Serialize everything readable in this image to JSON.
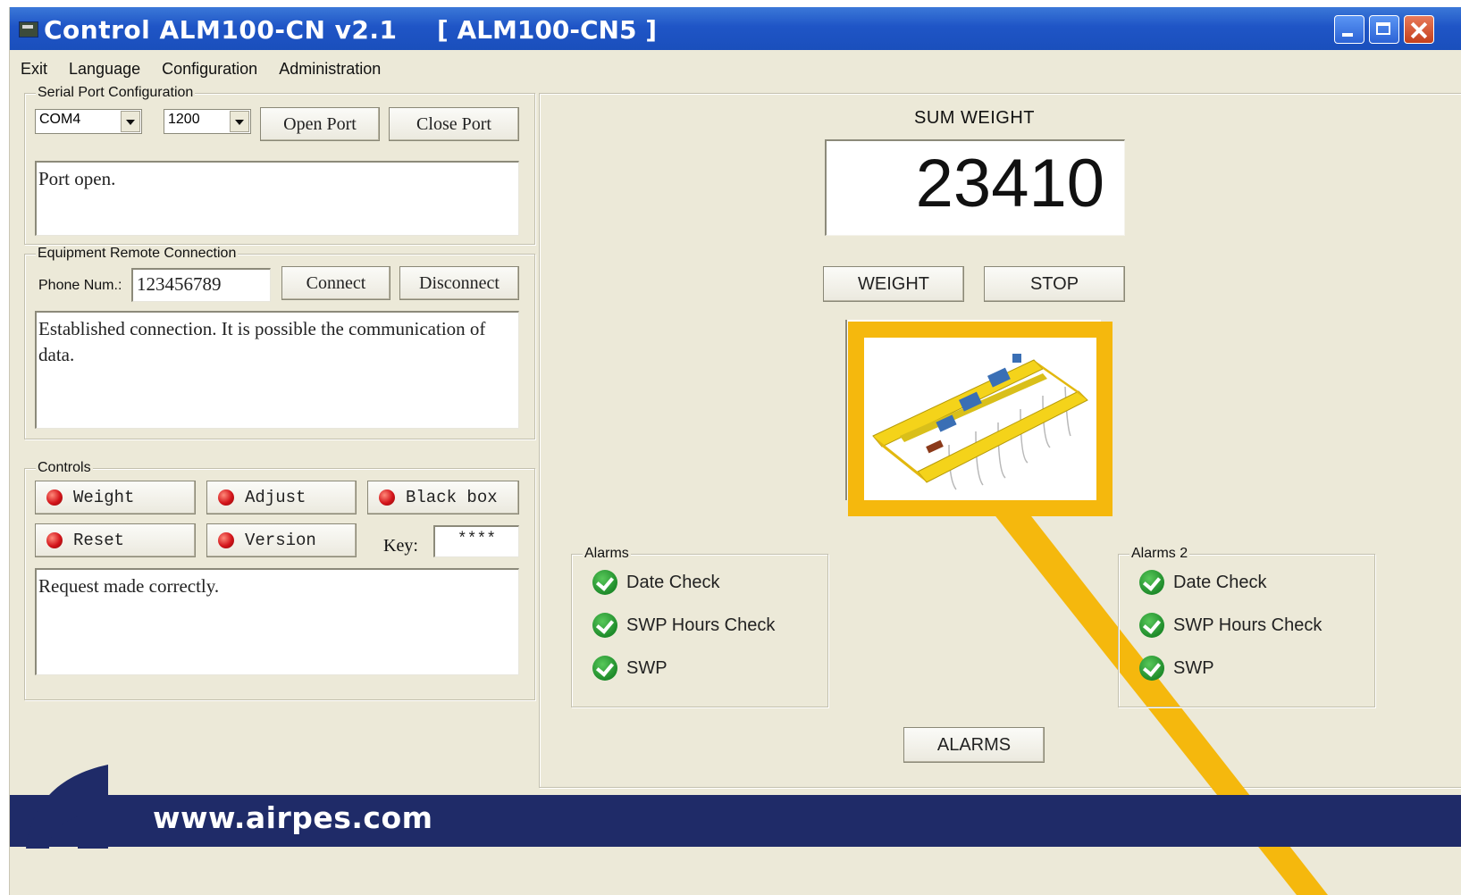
{
  "window": {
    "title": "Control ALM100-CN v2.1",
    "device": "[ ALM100-CN5  ]"
  },
  "menu": [
    "Exit",
    "Language",
    "Configuration",
    "Administration"
  ],
  "serial": {
    "group_title": "Serial Port Configuration",
    "port": "COM4",
    "baud": "1200",
    "open_label": "Open Port",
    "close_label": "Close Port",
    "log": "Port open."
  },
  "remote": {
    "group_title": "Equipment Remote Connection",
    "phone_label": "Phone Num.:",
    "phone_value": "123456789",
    "connect_label": "Connect",
    "disconnect_label": "Disconnect",
    "log": "Established connection. It is possible the communication of data."
  },
  "controls": {
    "group_title": "Controls",
    "buttons": [
      "Weight",
      "Adjust",
      "Black box",
      "Reset",
      "Version"
    ],
    "key_label": "Key:",
    "key_value": "****",
    "log": "Request made correctly."
  },
  "weight": {
    "title": "SUM WEIGHT",
    "value": "23410",
    "weight_button": "WEIGHT",
    "stop_button": "STOP",
    "alarms_button": "ALARMS"
  },
  "alarms1": {
    "title": "Alarms",
    "items": [
      "Date Check",
      "SWP Hours Check",
      "SWP"
    ]
  },
  "alarms2": {
    "title": "Alarms 2",
    "items": [
      "Date Check",
      "SWP Hours Check",
      "SWP"
    ]
  },
  "footer": {
    "url": "www.airpes.com"
  },
  "colors": {
    "titlebar": "#1f55c6",
    "window_bg": "#ece9d8",
    "footer_bg": "#1f2b68",
    "highlight": "#f5b80d",
    "ok_green": "#1e8b2a",
    "led_red": "#d3141a"
  }
}
